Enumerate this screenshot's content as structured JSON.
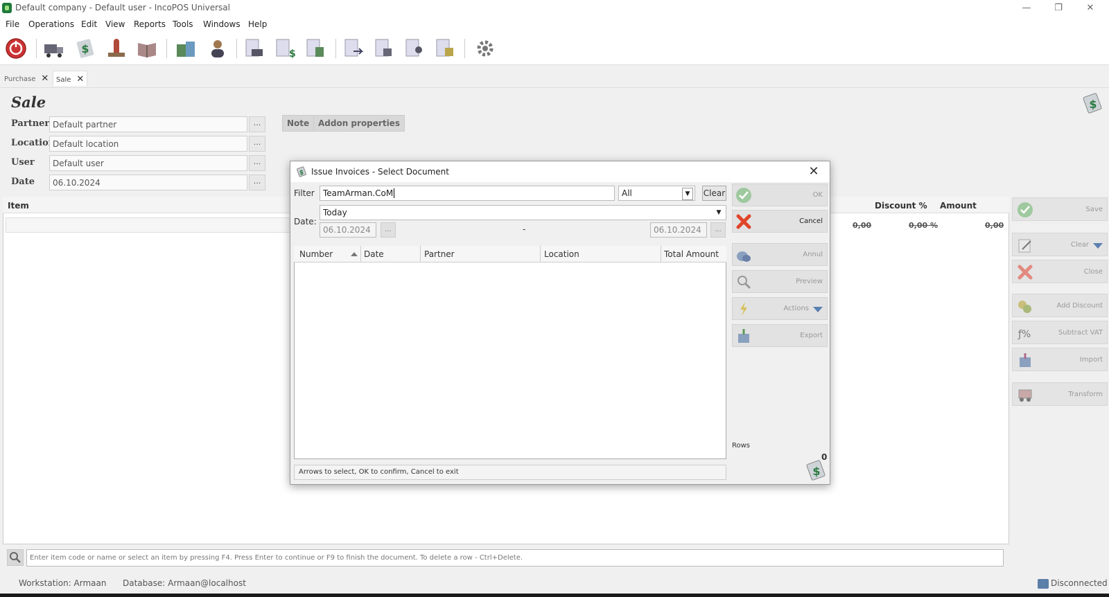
{
  "window": {
    "title": "Default company - Default user - IncoPOS Universal",
    "minimize_glyph": "—",
    "maximize_glyph": "❐",
    "close_glyph": "✕"
  },
  "menu": [
    "File",
    "Operations",
    "Edit",
    "View",
    "Reports",
    "Tools",
    "Windows",
    "Help"
  ],
  "toolbar_icons": [
    "power-icon",
    "truck-icon",
    "sale-dollar-icon",
    "stamp-icon",
    "book-icon",
    "boxes-icon",
    "user-icon",
    "doc-truck-icon",
    "doc-dollar-icon",
    "doc-boxes-icon",
    "doc-arrow-icon",
    "doc-arrow2-icon",
    "doc-people-icon",
    "doc-cube-icon",
    "settings-gear-icon"
  ],
  "tabs": [
    {
      "label": "Purchase",
      "close": "✕"
    },
    {
      "label": "Sale",
      "close": "✕"
    }
  ],
  "sale": {
    "title": "Sale",
    "partner_label": "Partner",
    "partner_value": "Default partner",
    "location_label": "Location",
    "location_value": "Default location",
    "user_label": "User",
    "user_value": "Default user",
    "date_label": "Date",
    "date_value": "06.10.2024",
    "dots": "...",
    "note_button": "Note",
    "addon_button": "Addon properties"
  },
  "grid": {
    "item_header": "Item",
    "discount_header": "Discount %",
    "amount_header": "Amount",
    "row_values": [
      "0,00",
      "0,00 %",
      "0,00"
    ]
  },
  "side_buttons": [
    "Save",
    "Clear",
    "Close",
    "Add Discount",
    "Subtract VAT",
    "Import",
    "Transform"
  ],
  "search_hint": "Enter item code or name or select an item by pressing F4. Press Enter to continue or F9 to finish the document. To delete a row - Ctrl+Delete.",
  "status": {
    "workstation": "Workstation: Armaan",
    "database": "Database: Armaan@localhost",
    "connection": "Disconnected"
  },
  "dialog": {
    "title": "Issue Invoices - Select Document",
    "close": "✕",
    "filter_label": "Filter",
    "filter_value": "TeamArman.CoM",
    "filter_scope": "All",
    "clear_button": "Clear",
    "period_value": "Today",
    "date_label": "Date:",
    "date_from": "06.10.2024",
    "date_to": "06.10.2024",
    "date_dash": "-",
    "dots": "...",
    "columns": [
      "Number",
      "Date",
      "Partner",
      "Location",
      "Total Amount"
    ],
    "hint": "Arrows to select, OK to confirm, Cancel to exit",
    "rows_label": "Rows",
    "rows_count": "0",
    "actions": [
      "OK",
      "Cancel",
      "Annul",
      "Preview",
      "Actions",
      "Export"
    ]
  },
  "colors": {
    "accent_green": "#5aa45a",
    "cancel_red": "#e0442a",
    "window_bg": "#f0f0f0"
  }
}
